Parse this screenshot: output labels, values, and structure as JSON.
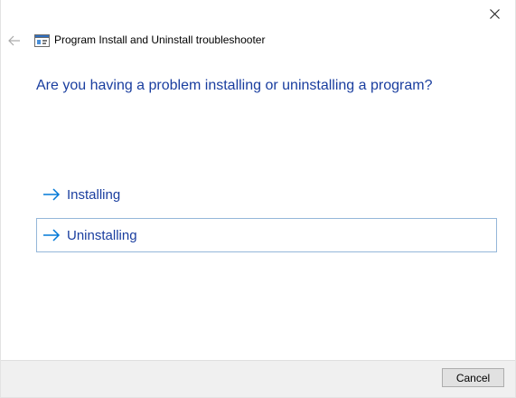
{
  "window": {
    "title": "Program Install and Uninstall troubleshooter"
  },
  "icons": {
    "close": "close-icon",
    "back": "back-arrow-icon",
    "app": "troubleshooter-app-icon",
    "option_arrow": "arrow-right-icon"
  },
  "main": {
    "heading": "Are you having a problem installing or uninstalling a program?",
    "options": [
      {
        "label": "Installing",
        "selected": false
      },
      {
        "label": "Uninstalling",
        "selected": true
      }
    ]
  },
  "footer": {
    "cancel_label": "Cancel"
  },
  "colors": {
    "accent_text": "#1a3e9f",
    "arrow": "#0078d7",
    "selected_border": "#95b7d9"
  }
}
